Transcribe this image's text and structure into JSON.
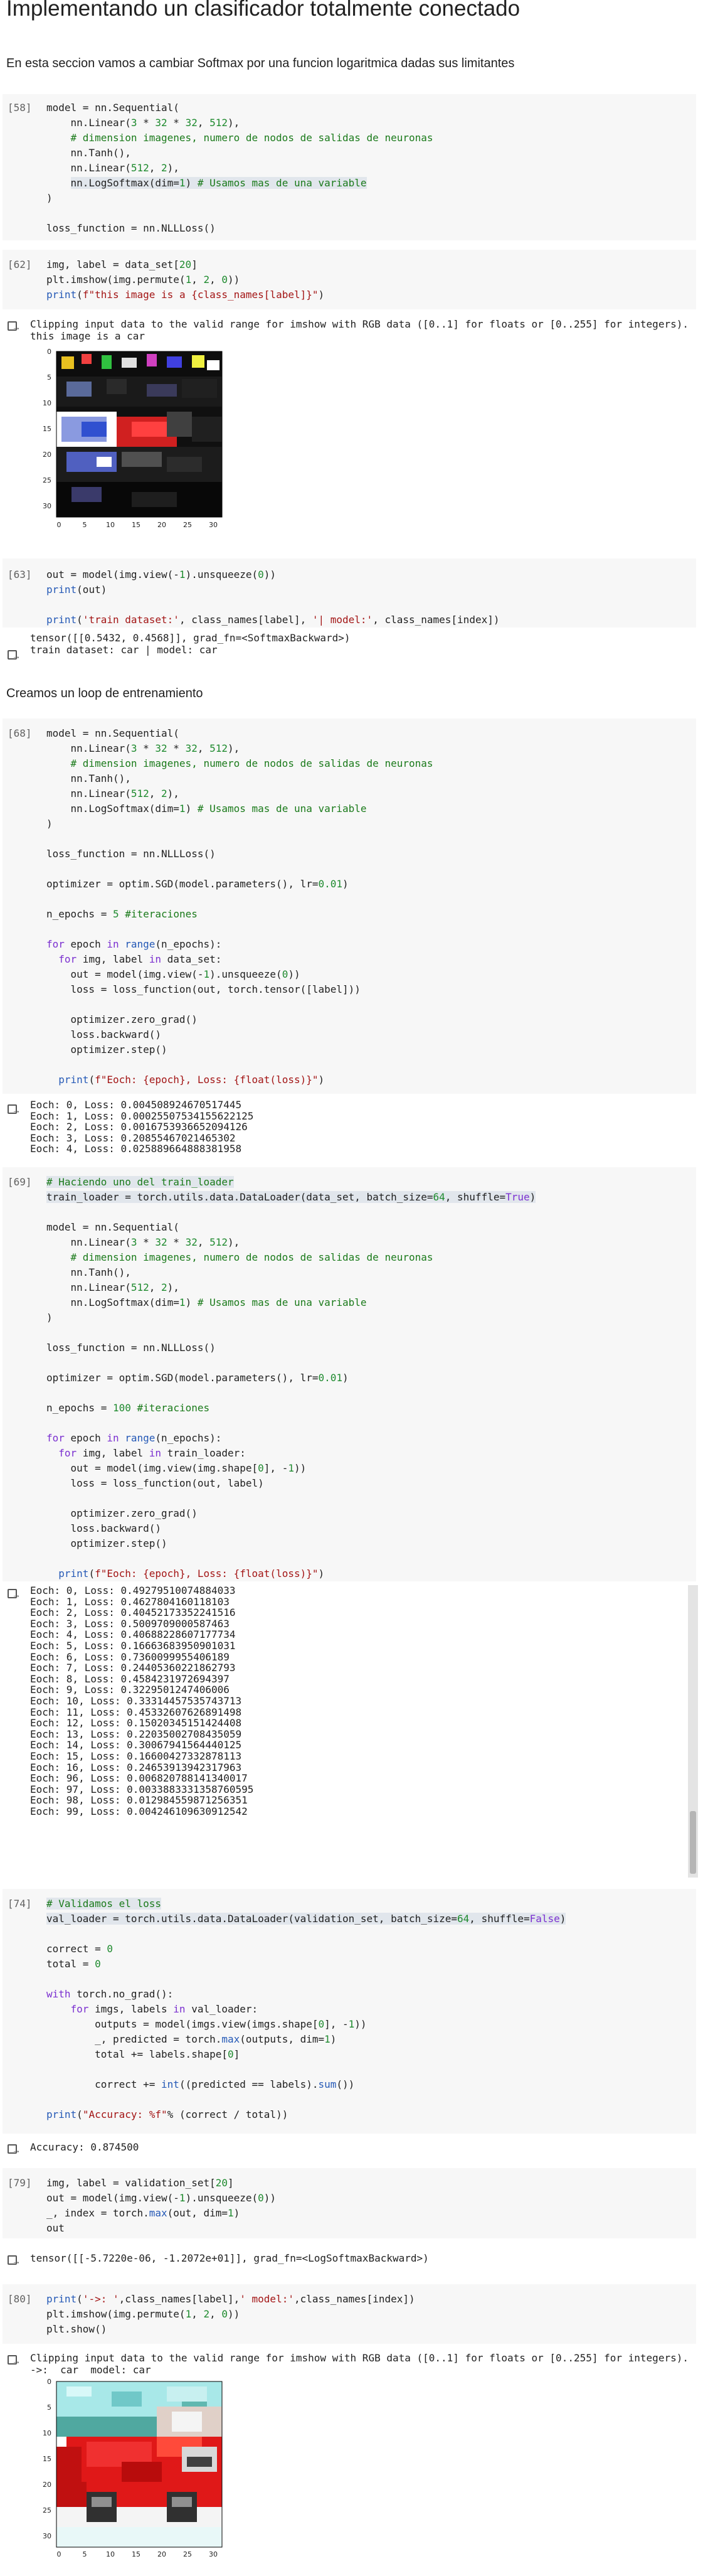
{
  "heading": "Implementando un clasificador totalmente conectado",
  "intro": "En esta seccion vamos a cambiar Softmax por una funcion logaritmica dadas sus limitantes",
  "md_loop": "Creamos un loop de entrenamiento",
  "prompts": {
    "c58": "[58]",
    "c62": "[62]",
    "c63": "[63]",
    "c68": "[68]",
    "c69": "[69]",
    "c74": "[74]",
    "c79": "[79]",
    "c80": "[80]"
  },
  "outputs": {
    "o62_line1": "Clipping input data to the valid range for imshow with RGB data ([0..1] for floats or [0..255] for integers).",
    "o62_line2": "this image is a car",
    "o63_line1": "tensor([[0.5432, 0.4568]], grad_fn=<SoftmaxBackward>)",
    "o63_line2": "train dataset: car | model: car",
    "o68_lines": [
      "Eoch: 0, Loss: 0.004508924670517445",
      "Eoch: 1, Loss: 0.00025507534155622125",
      "Eoch: 2, Loss: 0.0016753936652094126",
      "Eoch: 3, Loss: 0.20855467021465302",
      "Eoch: 4, Loss: 0.025889664888381958"
    ],
    "o69_lines": [
      "Eoch: 0, Loss: 0.49279510074884033",
      "Eoch: 1, Loss: 0.4627804160118103",
      "Eoch: 2, Loss: 0.40452173352241516",
      "Eoch: 3, Loss: 0.5009709000587463",
      "Eoch: 4, Loss: 0.40688228607177734",
      "Eoch: 5, Loss: 0.16663683950901031",
      "Eoch: 6, Loss: 0.7360099955406189",
      "Eoch: 7, Loss: 0.24405360221862793",
      "Eoch: 8, Loss: 0.4584231972694397",
      "Eoch: 9, Loss: 0.3229501247406006",
      "Eoch: 10, Loss: 0.33314457535743713",
      "Eoch: 11, Loss: 0.45332607626891498",
      "Eoch: 12, Loss: 0.15020345151424408",
      "Eoch: 13, Loss: 0.22035002708435059",
      "Eoch: 14, Loss: 0.30067941564440125",
      "Eoch: 15, Loss: 0.16600427332878113",
      "Eoch: 16, Loss: 0.24653913942317963",
      "Eoch: 96, Loss: 0.006820788141340017",
      "Eoch: 97, Loss: 0.0033883331358760595",
      "Eoch: 98, Loss: 0.012984559871256351",
      "Eoch: 99, Loss: 0.004246109630912542"
    ],
    "o74": "Accuracy: 0.874500",
    "o79": "tensor([[-5.7220e-06, -1.2072e+01]], grad_fn=<LogSoftmaxBackward>)",
    "o80_line1": "Clipping input data to the valid range for imshow with RGB data ([0..1] for floats or [0..255] for integers).",
    "o80_line2": "->:  car  model: car"
  },
  "plots": {
    "ticks": [
      "0",
      "5",
      "10",
      "15",
      "20",
      "25",
      "30"
    ]
  }
}
